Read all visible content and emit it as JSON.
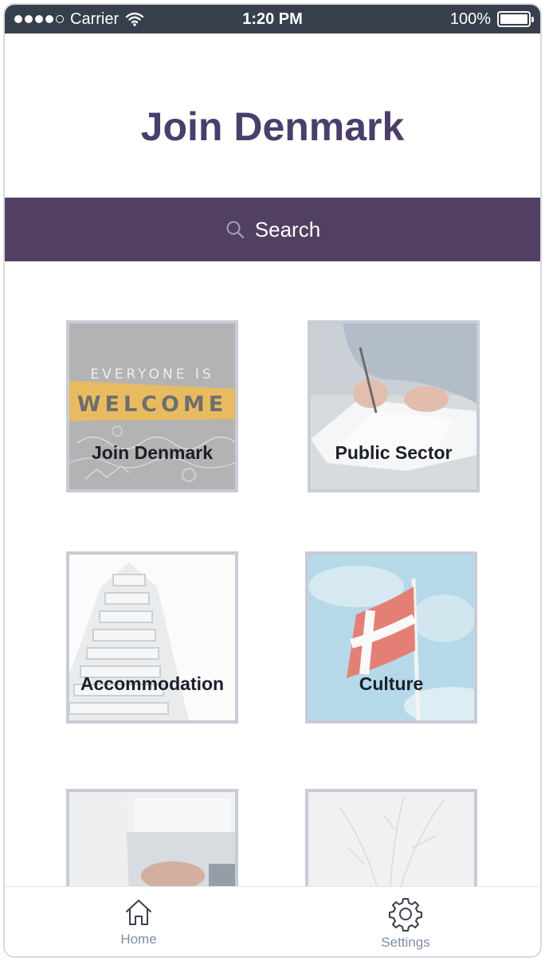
{
  "status_bar": {
    "carrier": "Carrier",
    "time": "1:20 PM",
    "battery": "100%"
  },
  "title": "Join Denmark",
  "search": {
    "label": "Search"
  },
  "tiles": [
    {
      "label": "Join Denmark",
      "sign_line1": "EVERYONE IS",
      "sign_line2": "WELCOME"
    },
    {
      "label": "Public Sector"
    },
    {
      "label": "Accommodation"
    },
    {
      "label": "Culture"
    },
    {
      "label": ""
    },
    {
      "label": ""
    }
  ],
  "tabs": [
    {
      "label": "Home",
      "icon": "home-icon"
    },
    {
      "label": "Settings",
      "icon": "gear-icon"
    }
  ],
  "colors": {
    "status_bar": "#363f4b",
    "title": "#4a3e6b",
    "search_bar": "#514062",
    "tile_border": "#c7ccd6",
    "tab_label": "#7f8ea8"
  }
}
